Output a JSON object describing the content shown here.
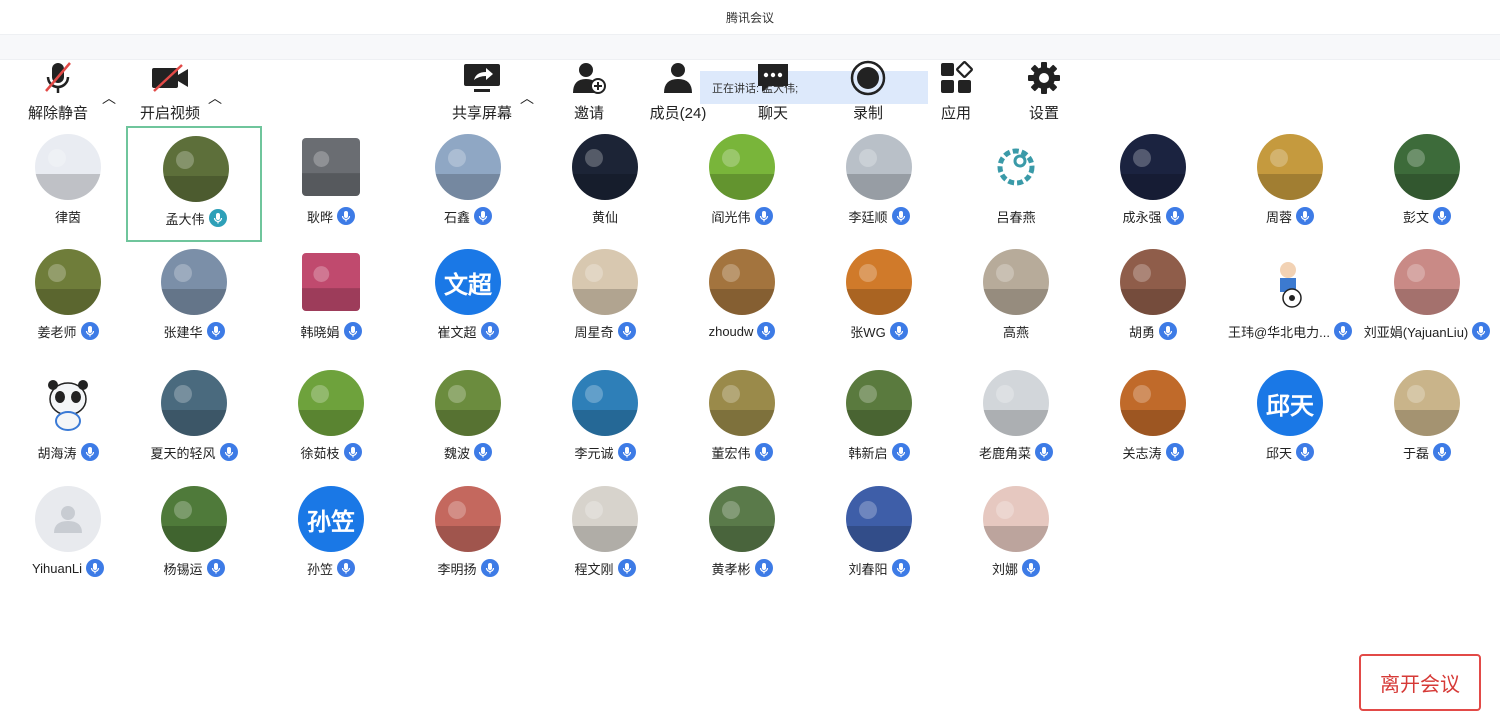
{
  "window": {
    "title": "腾讯会议"
  },
  "speaking": {
    "label": "正在讲话: 孟大伟;"
  },
  "participants": [
    {
      "name": "律茵",
      "mic": false,
      "bg": "#e9ecf2"
    },
    {
      "name": "孟大伟",
      "mic": true,
      "active": true,
      "bg": "#5d6f3a"
    },
    {
      "name": "耿晔",
      "mic": true,
      "shape": "square",
      "bg": "#6a6d72"
    },
    {
      "name": "石鑫",
      "mic": true,
      "bg": "#8fa7c4"
    },
    {
      "name": "黄仙",
      "mic": false,
      "bg": "#1c2436"
    },
    {
      "name": "阎光伟",
      "mic": true,
      "bg": "#79b53a"
    },
    {
      "name": "李廷顺",
      "mic": true,
      "bg": "#b9c0c8"
    },
    {
      "name": "吕春燕",
      "mic": false,
      "bg": "#ffffff",
      "logo": true
    },
    {
      "name": "成永强",
      "mic": true,
      "bg": "#1b2340"
    },
    {
      "name": "周蓉",
      "mic": true,
      "bg": "#c59a3e"
    },
    {
      "name": "彭文",
      "mic": true,
      "bg": "#3d6b3a"
    },
    {
      "name": "姜老师",
      "mic": true,
      "bg": "#6f7d3a"
    },
    {
      "name": "张建华",
      "mic": true,
      "bg": "#7b8fa8"
    },
    {
      "name": "韩晓娟",
      "mic": true,
      "shape": "square",
      "bg": "#c04a6e"
    },
    {
      "name": "崔文超",
      "mic": true,
      "bg": "#1a78e6",
      "text": "文超"
    },
    {
      "name": "周星奇",
      "mic": true,
      "bg": "#d8c8b0"
    },
    {
      "name": "zhoudw",
      "mic": true,
      "bg": "#a3743e"
    },
    {
      "name": "张WG",
      "mic": true,
      "bg": "#d07a2a"
    },
    {
      "name": "高燕",
      "mic": false,
      "bg": "#b7ab9a"
    },
    {
      "name": "胡勇",
      "mic": true,
      "bg": "#8f5d4a"
    },
    {
      "name": "王玮@华北电力...",
      "mic": true,
      "bg": "#ffffff",
      "ball": true
    },
    {
      "name": "刘亚娟(YajuanLiu)",
      "mic": true,
      "bg": "#c98a86"
    },
    {
      "name": "胡海涛",
      "mic": true,
      "bg": "#ffffff",
      "panda": true
    },
    {
      "name": "夏天的轻风",
      "mic": true,
      "bg": "#4a6a7e"
    },
    {
      "name": "徐茹枝",
      "mic": true,
      "bg": "#6ea23c"
    },
    {
      "name": "魏波",
      "mic": true,
      "bg": "#6b8c3e"
    },
    {
      "name": "李元诚",
      "mic": true,
      "bg": "#2e7fb8"
    },
    {
      "name": "董宏伟",
      "mic": true,
      "bg": "#9a8a4a"
    },
    {
      "name": "韩新启",
      "mic": true,
      "bg": "#5a7a3e"
    },
    {
      "name": "老鹿角菜",
      "mic": true,
      "bg": "#d2d6da"
    },
    {
      "name": "关志涛",
      "mic": true,
      "bg": "#c06a2a"
    },
    {
      "name": "邱天",
      "mic": true,
      "bg": "#1a78e6",
      "text": "邱天"
    },
    {
      "name": "于磊",
      "mic": true,
      "bg": "#c9b48a"
    },
    {
      "name": "YihuanLi",
      "mic": true,
      "bg": "#e8eaee",
      "default": true
    },
    {
      "name": "杨锡运",
      "mic": true,
      "bg": "#4f7a3a"
    },
    {
      "name": "孙笠",
      "mic": true,
      "bg": "#1a78e6",
      "text": "孙笠"
    },
    {
      "name": "李明扬",
      "mic": true,
      "bg": "#c4685e"
    },
    {
      "name": "程文刚",
      "mic": true,
      "bg": "#d7d3cc"
    },
    {
      "name": "黄孝彬",
      "mic": true,
      "bg": "#5a7a4a"
    },
    {
      "name": "刘春阳",
      "mic": true,
      "bg": "#3e5ea8"
    },
    {
      "name": "刘娜",
      "mic": true,
      "bg": "#e6c8c0"
    }
  ],
  "toolbar": {
    "unmute": "解除静音",
    "start_video": "开启视频",
    "share_screen": "共享屏幕",
    "invite": "邀请",
    "members": "成员(24)",
    "chat": "聊天",
    "record": "录制",
    "apps": "应用",
    "settings": "设置",
    "leave": "离开会议"
  }
}
